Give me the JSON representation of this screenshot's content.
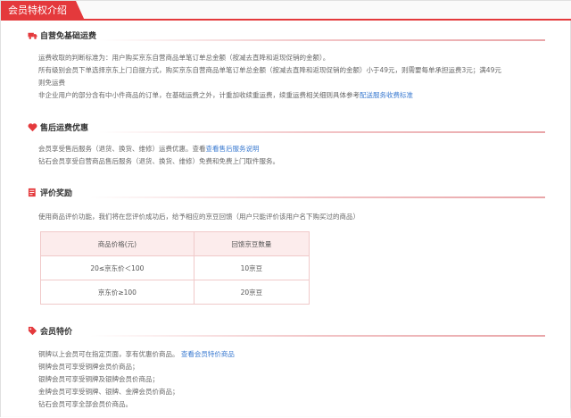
{
  "tab": {
    "title": "会员特权介绍"
  },
  "sections": {
    "freight": {
      "title": "自营免基础运费",
      "lines": [
        "运费收取的判断标准为：用户购买京东自营商品单笔订单总金额（按减去直降和返现促销的金额）。",
        "所有级别会员下单选择京东上门自提方式，购买京东自营商品单笔订单总金额（按减去直降和返现促销的金额）小于49元，则需要每单承担运费3元；满49元",
        "则免运费",
        "非企业用户的部分含有中小件商品的订单，在基础运费之外，计重加收续重运费，续重运费相关细则具体参考"
      ],
      "link": "配送服务收费标准"
    },
    "aftersale": {
      "title": "售后运费优惠",
      "line1": "会员享受售后服务（退货、换货、维修）运费优惠。查看",
      "line1_link": "查看售后服务说明",
      "line2": "钻石会员享受自营商品售后服务（退货、换货、维修）免费和免费上门取件服务。"
    },
    "review": {
      "title": "评价奖励",
      "line1": "使用商品评价功能，我们将在您评价成功后，给予相应的京豆回馈（用户只能评价该用户名下购买过的商品）",
      "table": {
        "headers": [
          "商品价格(元)",
          "回馈京豆数量"
        ],
        "rows": [
          [
            "20≤京东价＜100",
            "10京豆"
          ],
          [
            "京东价≥100",
            "20京豆"
          ]
        ]
      }
    },
    "price": {
      "title": "会员特价",
      "line1": "铜牌以上会员可在指定页面，享有优惠价商品。",
      "line1_link": "查看会员特价商品",
      "lines": [
        "铜牌会员可享受铜牌会员价商品；",
        "银牌会员可享受铜牌及银牌会员价商品；",
        "金牌会员可享受铜牌、银牌、金牌会员价商品；",
        "钻石会员可享全部会员价商品。"
      ]
    }
  },
  "colors": {
    "accent": "#e4393c",
    "link": "#3a7ad0"
  }
}
